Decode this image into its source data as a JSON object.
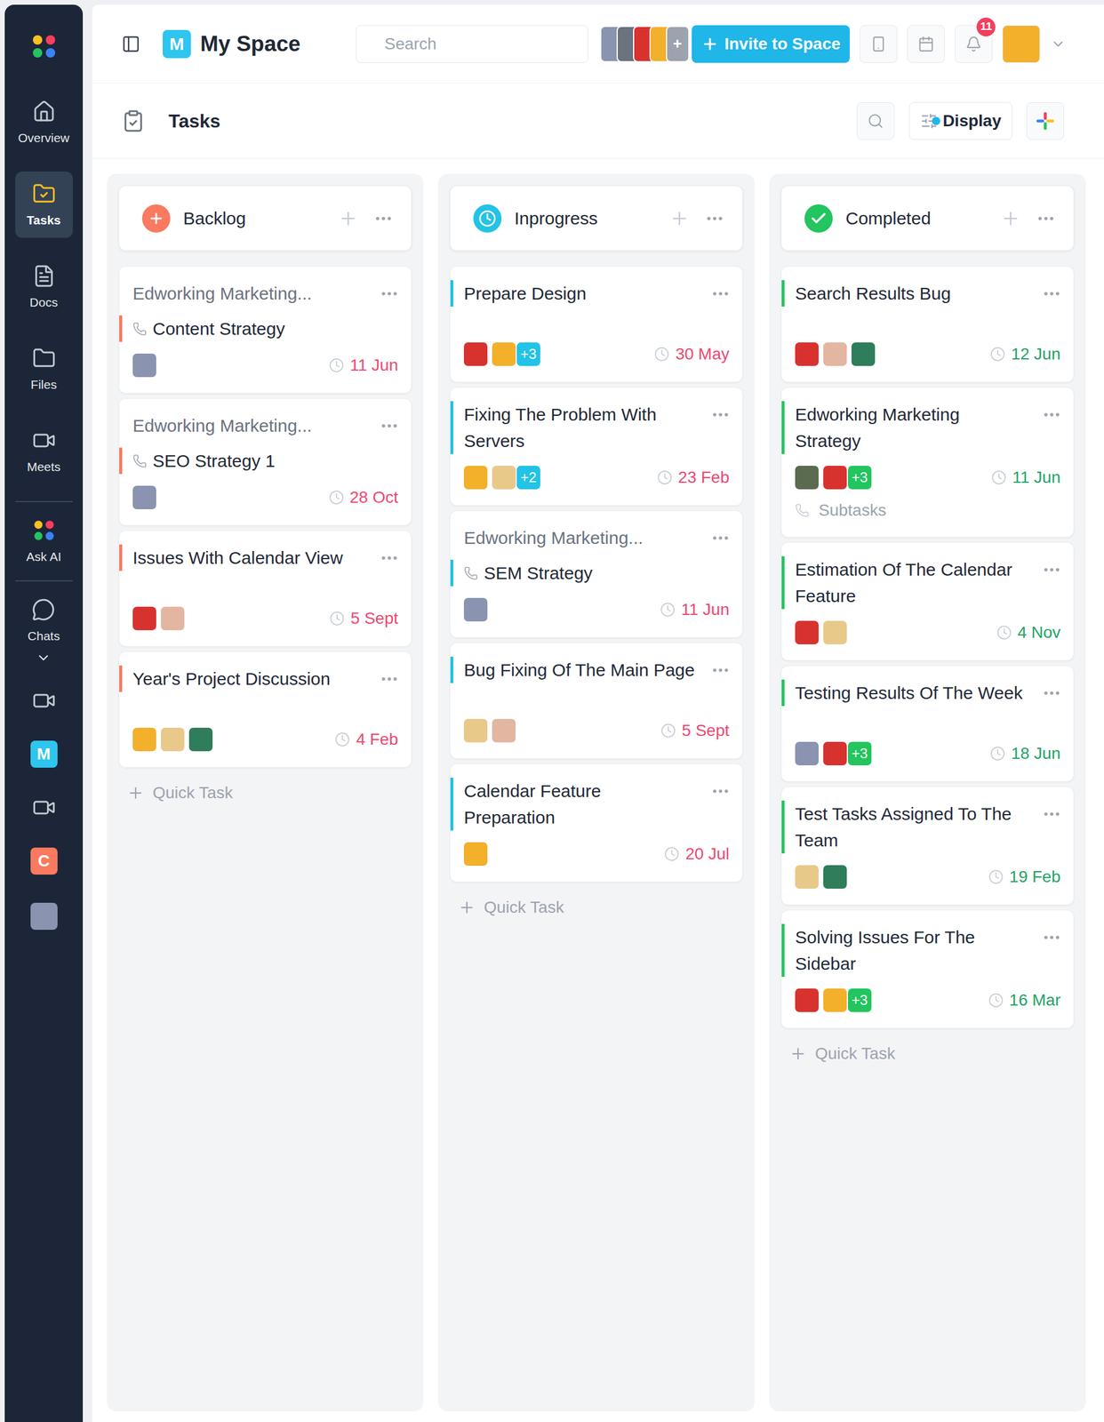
{
  "sidebar": {
    "items": [
      {
        "label": "Overview",
        "selected": false
      },
      {
        "label": "Tasks",
        "selected": true
      },
      {
        "label": "Docs",
        "selected": false
      },
      {
        "label": "Files",
        "selected": false
      },
      {
        "label": "Meets",
        "selected": false
      }
    ],
    "ask_ai": {
      "label": "Ask AI",
      "selected": false
    },
    "chats": {
      "label": "Chats",
      "expanded": true,
      "items": [
        {
          "kind": "video"
        },
        {
          "kind": "letter",
          "letter": "M",
          "color": "#2ec5ee"
        },
        {
          "kind": "video"
        },
        {
          "kind": "letter",
          "letter": "C",
          "color": "#f97a5f"
        },
        {
          "kind": "image",
          "color": "#8a94b0"
        }
      ]
    }
  },
  "topbar": {
    "space_badge": "M",
    "title": "My Space",
    "search": {
      "placeholder": "Search"
    },
    "members": [
      "#8a94b0",
      "#6b7280",
      "#d8322f",
      "#f2b02b"
    ],
    "members_more": "+",
    "invite": "Invite to Space",
    "notifications": "11",
    "user_avatar_color": "#f2b02b"
  },
  "page": {
    "title": "Tasks",
    "display": "Display"
  },
  "columns": [
    {
      "title": "Backlog",
      "kind": "backlog",
      "color": "#f97a5f",
      "date_color": "#ef476f",
      "quick_task": "Quick Task",
      "cards": [
        {
          "kind": "subtask",
          "parent": "Edworking Marketing...",
          "title": "Content Strategy",
          "avatars": [
            "#8a94b0"
          ],
          "date": "11 Jun"
        },
        {
          "kind": "subtask",
          "parent": "Edworking Marketing...",
          "title": "SEO Strategy 1",
          "avatars": [
            "#8a94b0"
          ],
          "date": "28 Oct"
        },
        {
          "kind": "task",
          "title": "Issues With Calendar View",
          "avatars": [
            "#d8322f",
            "#e3b6a2"
          ],
          "date": "5 Sept"
        },
        {
          "kind": "task",
          "title": "Year's Project Discussion",
          "avatars": [
            "#f2b02b",
            "#e9c98a",
            "#2f7d5b"
          ],
          "date": "4 Feb"
        }
      ]
    },
    {
      "title": "Inprogress",
      "kind": "progress",
      "color": "#22c3e6",
      "date_color": "#ef476f",
      "quick_task": "Quick Task",
      "cards": [
        {
          "kind": "task",
          "title": "Prepare Design",
          "avatars": [
            "#d8322f",
            "#f2b02b"
          ],
          "extra": "+3",
          "date": "30 May"
        },
        {
          "kind": "task",
          "title": "Fixing The Problem With Servers",
          "avatars": [
            "#f2b02b",
            "#e9c98a"
          ],
          "extra": "+2",
          "date": "23 Feb"
        },
        {
          "kind": "subtask",
          "parent": "Edworking Marketing...",
          "title": "SEM Strategy",
          "avatars": [
            "#8a94b0"
          ],
          "date": "11 Jun"
        },
        {
          "kind": "task",
          "title": "Bug Fixing Of The Main Page",
          "avatars": [
            "#e9c98a",
            "#e3b6a2"
          ],
          "date": "5 Sept"
        },
        {
          "kind": "task",
          "title": "Calendar Feature Preparation",
          "avatars": [
            "#f2b02b"
          ],
          "date": "20 Jul"
        }
      ]
    },
    {
      "title": "Completed",
      "kind": "completed",
      "color": "#22c55e",
      "date_color": "#1fa463",
      "quick_task": "Quick Task",
      "cards": [
        {
          "kind": "task",
          "title": "Search Results Bug",
          "avatars": [
            "#d8322f",
            "#e3b6a2",
            "#2f7d5b"
          ],
          "date": "12 Jun"
        },
        {
          "kind": "task",
          "title": "Edworking Marketing Strategy",
          "avatars": [
            "#5b6b4f",
            "#d8322f"
          ],
          "extra": "+3",
          "date": "11 Jun",
          "subtasks": "Subtasks"
        },
        {
          "kind": "task",
          "title": "Estimation Of The Calendar Feature",
          "avatars": [
            "#d8322f",
            "#e9c98a"
          ],
          "date": "4 Nov"
        },
        {
          "kind": "task",
          "title": "Testing Results Of The Week",
          "avatars": [
            "#8a94b0",
            "#d8322f"
          ],
          "extra": "+3",
          "date": "18 Jun"
        },
        {
          "kind": "task",
          "title": "Test Tasks Assigned To The Team",
          "avatars": [
            "#e9c98a",
            "#2f7d5b"
          ],
          "date": "19 Feb"
        },
        {
          "kind": "task",
          "title": "Solving Issues For The Sidebar",
          "avatars": [
            "#d8322f",
            "#f2b02b"
          ],
          "extra": "+3",
          "date": "16 Mar"
        }
      ]
    }
  ]
}
